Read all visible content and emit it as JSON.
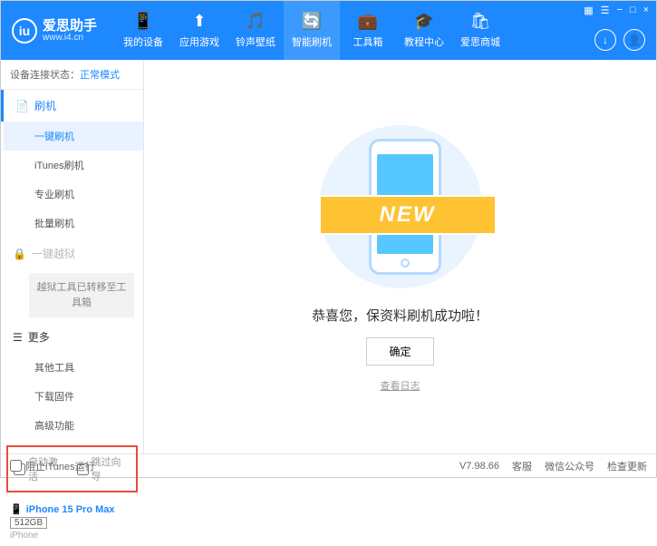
{
  "app": {
    "title": "爱思助手",
    "url": "www.i4.cn",
    "logo_letter": "iu"
  },
  "window_controls": {
    "cart": "▦",
    "menu": "☰",
    "min": "−",
    "max": "□",
    "close": "×"
  },
  "top_nav": [
    {
      "icon": "📱",
      "label": "我的设备"
    },
    {
      "icon": "⬆",
      "label": "应用游戏"
    },
    {
      "icon": "🎵",
      "label": "铃声壁纸"
    },
    {
      "icon": "🔄",
      "label": "智能刷机"
    },
    {
      "icon": "💼",
      "label": "工具箱"
    },
    {
      "icon": "🎓",
      "label": "教程中心"
    },
    {
      "icon": "🛍",
      "label": "爱思商城"
    }
  ],
  "top_nav_active_index": 3,
  "right_circles": {
    "download": "↓",
    "user": "👤"
  },
  "status": {
    "label": "设备连接状态：",
    "mode": "正常模式"
  },
  "sidebar": {
    "flash_group": {
      "icon": "📄",
      "label": "刷机"
    },
    "flash_items": [
      "一键刷机",
      "iTunes刷机",
      "专业刷机",
      "批量刷机"
    ],
    "jailbreak": {
      "icon": "🔒",
      "label": "一键越狱",
      "note": "越狱工具已转移至工具箱"
    },
    "more_group": {
      "icon": "☰",
      "label": "更多"
    },
    "more_items": [
      "其他工具",
      "下载固件",
      "高级功能"
    ]
  },
  "checkboxes": {
    "auto_activate": "自动激活",
    "skip_guide": "跳过向导"
  },
  "device": {
    "name": "iPhone 15 Pro Max",
    "storage": "512GB",
    "type": "iPhone"
  },
  "main": {
    "banner_text": "NEW",
    "success_msg": "恭喜您，保资料刷机成功啦！",
    "ok": "确定",
    "view_log": "查看日志"
  },
  "footer": {
    "block_itunes": "阻止iTunes运行",
    "version": "V7.98.66",
    "links": [
      "客服",
      "微信公众号",
      "检查更新"
    ]
  }
}
